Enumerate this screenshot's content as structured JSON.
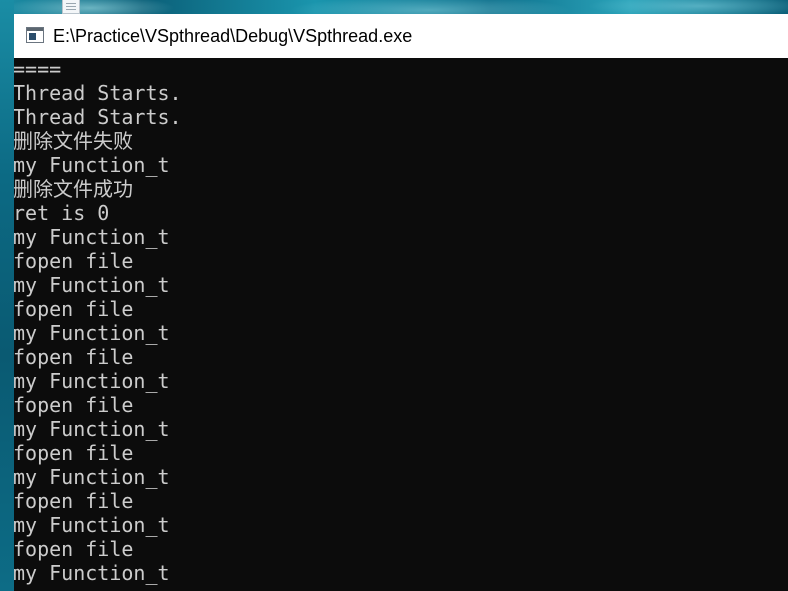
{
  "window": {
    "title": "E:\\Practice\\VSpthread\\Debug\\VSpthread.exe",
    "icon": "console-app-icon"
  },
  "console": {
    "background": "#0c0c0c",
    "text_color": "#cccccc",
    "lines": [
      "====",
      "Thread Starts.",
      "Thread Starts.",
      "删除文件失败",
      "my Function_t",
      "删除文件成功",
      "ret is 0",
      "my Function_t",
      "fopen file",
      "my Function_t",
      "fopen file",
      "my Function_t",
      "fopen file",
      "my Function_t",
      "fopen file",
      "my Function_t",
      "fopen file",
      "my Function_t",
      "fopen file",
      "my Function_t",
      "fopen file",
      "my Function_t"
    ]
  },
  "desktop": {
    "icon": "file-icon"
  }
}
